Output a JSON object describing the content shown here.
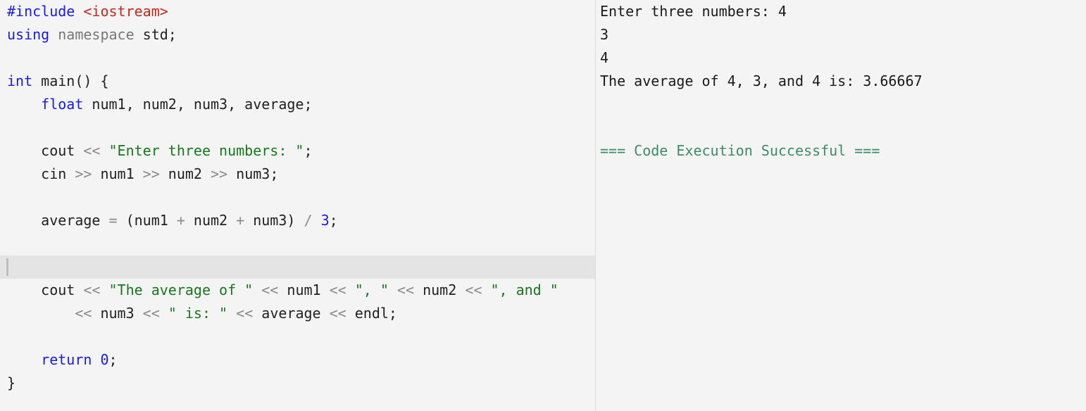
{
  "editor": {
    "active_line": 11,
    "lines": [
      [
        {
          "t": "#include",
          "c": "pre"
        },
        {
          "t": " ",
          "c": "id"
        },
        {
          "t": "<iostream>",
          "c": "inc"
        }
      ],
      [
        {
          "t": "using",
          "c": "kw"
        },
        {
          "t": " ",
          "c": "id"
        },
        {
          "t": "namespace",
          "c": "ns"
        },
        {
          "t": " std;",
          "c": "id"
        }
      ],
      [],
      [
        {
          "t": "int",
          "c": "kw"
        },
        {
          "t": " main() {",
          "c": "id"
        }
      ],
      [
        {
          "t": "    ",
          "c": "id"
        },
        {
          "t": "float",
          "c": "kw"
        },
        {
          "t": " num1, num2, num3, average;",
          "c": "id"
        }
      ],
      [],
      [
        {
          "t": "    cout ",
          "c": "id"
        },
        {
          "t": "<<",
          "c": "op"
        },
        {
          "t": " ",
          "c": "id"
        },
        {
          "t": "\"Enter three numbers: \"",
          "c": "str"
        },
        {
          "t": ";",
          "c": "id"
        }
      ],
      [
        {
          "t": "    cin ",
          "c": "id"
        },
        {
          "t": ">>",
          "c": "op"
        },
        {
          "t": " num1 ",
          "c": "id"
        },
        {
          "t": ">>",
          "c": "op"
        },
        {
          "t": " num2 ",
          "c": "id"
        },
        {
          "t": ">>",
          "c": "op"
        },
        {
          "t": " num3;",
          "c": "id"
        }
      ],
      [],
      [
        {
          "t": "    average ",
          "c": "id"
        },
        {
          "t": "=",
          "c": "op"
        },
        {
          "t": " (num1 ",
          "c": "id"
        },
        {
          "t": "+",
          "c": "op"
        },
        {
          "t": " num2 ",
          "c": "id"
        },
        {
          "t": "+",
          "c": "op"
        },
        {
          "t": " num3) ",
          "c": "id"
        },
        {
          "t": "/",
          "c": "op"
        },
        {
          "t": " ",
          "c": "id"
        },
        {
          "t": "3",
          "c": "num"
        },
        {
          "t": ";",
          "c": "id"
        }
      ],
      [],
      [],
      [
        {
          "t": "    cout ",
          "c": "id"
        },
        {
          "t": "<<",
          "c": "op"
        },
        {
          "t": " ",
          "c": "id"
        },
        {
          "t": "\"The average of \"",
          "c": "str"
        },
        {
          "t": " ",
          "c": "id"
        },
        {
          "t": "<<",
          "c": "op"
        },
        {
          "t": " num1 ",
          "c": "id"
        },
        {
          "t": "<<",
          "c": "op"
        },
        {
          "t": " ",
          "c": "id"
        },
        {
          "t": "\", \"",
          "c": "str"
        },
        {
          "t": " ",
          "c": "id"
        },
        {
          "t": "<<",
          "c": "op"
        },
        {
          "t": " num2 ",
          "c": "id"
        },
        {
          "t": "<<",
          "c": "op"
        },
        {
          "t": " ",
          "c": "id"
        },
        {
          "t": "\", and \"",
          "c": "str"
        }
      ],
      [
        {
          "t": "        ",
          "c": "id"
        },
        {
          "t": "<<",
          "c": "op"
        },
        {
          "t": " num3 ",
          "c": "id"
        },
        {
          "t": "<<",
          "c": "op"
        },
        {
          "t": " ",
          "c": "id"
        },
        {
          "t": "\" is: \"",
          "c": "str"
        },
        {
          "t": " ",
          "c": "id"
        },
        {
          "t": "<<",
          "c": "op"
        },
        {
          "t": " average ",
          "c": "id"
        },
        {
          "t": "<<",
          "c": "op"
        },
        {
          "t": " endl;",
          "c": "id"
        }
      ],
      [],
      [
        {
          "t": "    ",
          "c": "id"
        },
        {
          "t": "return",
          "c": "kw"
        },
        {
          "t": " ",
          "c": "id"
        },
        {
          "t": "0",
          "c": "num"
        },
        {
          "t": ";",
          "c": "id"
        }
      ],
      [
        {
          "t": "}",
          "c": "id"
        }
      ]
    ]
  },
  "output": {
    "lines": [
      "Enter three numbers: 4",
      "3",
      "4",
      "The average of 4, 3, and 4 is: 3.66667",
      "",
      "",
      "=== Code Execution Successful ==="
    ],
    "success_line": "=== Code Execution Successful ==="
  },
  "colors": {
    "keyword": "#1a1ae8",
    "include_path": "#c4281c",
    "string": "#16781a",
    "operator": "#8a8a8a",
    "success": "#3e8a6a"
  }
}
